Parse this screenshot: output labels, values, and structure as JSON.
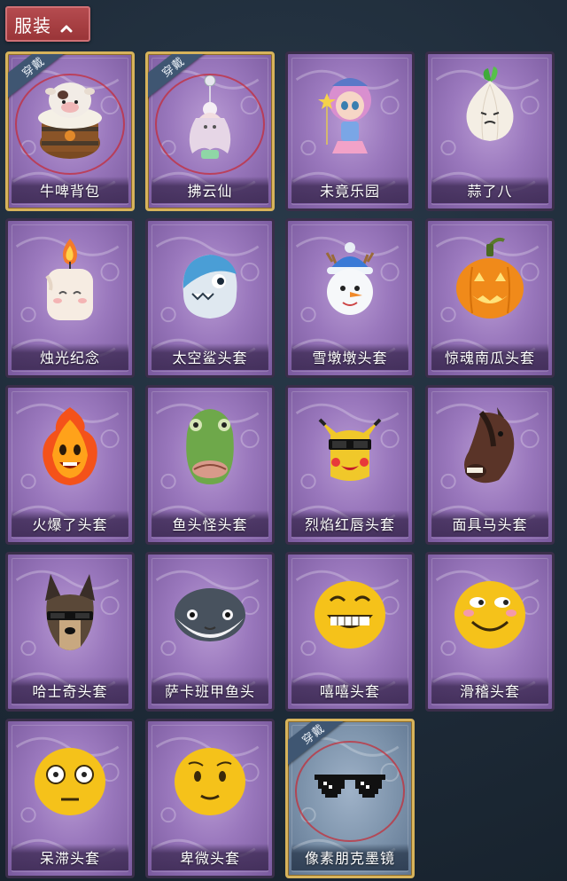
{
  "header": {
    "title": "服装",
    "icon": "chevron-up-icon"
  },
  "colors": {
    "header_bg": "#a83f43",
    "card_purple": "#9a78bd",
    "card_blue": "#7f95ad",
    "equipped_border": "#d7b35b",
    "badge_bg": "#3f5672"
  },
  "items": [
    {
      "name": "牛啤背包",
      "icon": "cow-beer-backpack-icon",
      "equipped": true,
      "badge": "穿戴",
      "style": "purple"
    },
    {
      "name": "拂云仙",
      "icon": "cloud-fairy-charm-icon",
      "equipped": true,
      "badge": "穿戴",
      "style": "purple"
    },
    {
      "name": "未竟乐园",
      "icon": "unfinished-paradise-doll-icon",
      "equipped": false,
      "style": "purple"
    },
    {
      "name": "蒜了八",
      "icon": "garlic-icon",
      "equipped": false,
      "style": "purple"
    },
    {
      "name": "烛光纪念",
      "icon": "candle-head-icon",
      "equipped": false,
      "style": "purple"
    },
    {
      "name": "太空鲨头套",
      "icon": "space-shark-head-icon",
      "equipped": false,
      "style": "purple"
    },
    {
      "name": "雪墩墩头套",
      "icon": "snowman-head-icon",
      "equipped": false,
      "style": "purple"
    },
    {
      "name": "惊魂南瓜头套",
      "icon": "pumpkin-head-icon",
      "equipped": false,
      "style": "purple"
    },
    {
      "name": "火爆了头套",
      "icon": "fire-head-icon",
      "equipped": false,
      "style": "purple"
    },
    {
      "name": "鱼头怪头套",
      "icon": "fish-monster-head-icon",
      "equipped": false,
      "style": "purple"
    },
    {
      "name": "烈焰红唇头套",
      "icon": "red-lips-pikachu-head-icon",
      "equipped": false,
      "style": "purple"
    },
    {
      "name": "面具马头套",
      "icon": "horse-mask-head-icon",
      "equipped": false,
      "style": "purple"
    },
    {
      "name": "哈士奇头套",
      "icon": "husky-head-icon",
      "equipped": false,
      "style": "purple"
    },
    {
      "name": "萨卡班甲鱼头",
      "icon": "sacabambaspis-head-icon",
      "equipped": false,
      "style": "purple"
    },
    {
      "name": "嘻嘻头套",
      "icon": "grin-emoji-head-icon",
      "equipped": false,
      "style": "purple"
    },
    {
      "name": "滑稽头套",
      "icon": "funny-emoji-head-icon",
      "equipped": false,
      "style": "purple"
    },
    {
      "name": "呆滞头套",
      "icon": "stunned-emoji-head-icon",
      "equipped": false,
      "style": "purple"
    },
    {
      "name": "卑微头套",
      "icon": "humble-emoji-head-icon",
      "equipped": false,
      "style": "purple"
    },
    {
      "name": "像素朋克墨镜",
      "icon": "pixel-sunglasses-icon",
      "equipped": true,
      "badge": "穿戴",
      "style": "blue"
    }
  ]
}
